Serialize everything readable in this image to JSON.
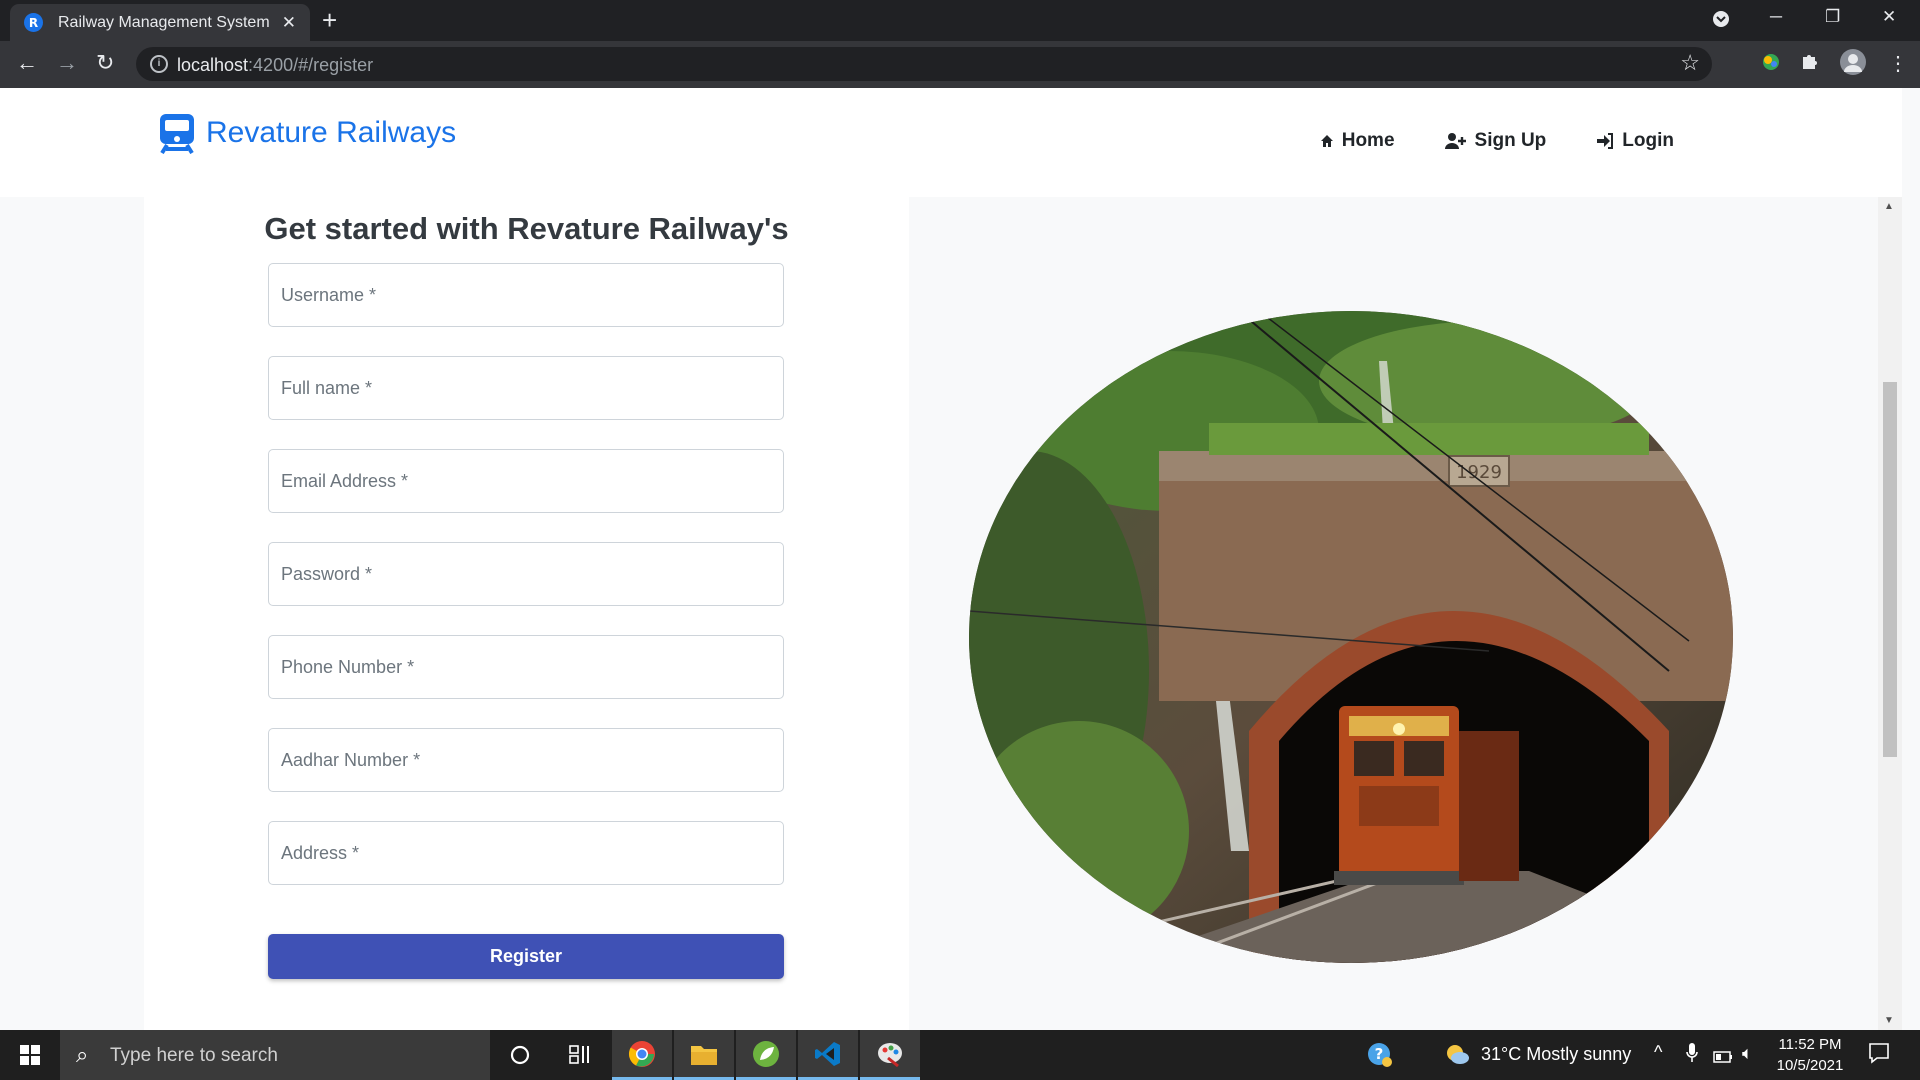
{
  "browser": {
    "tab_title": "Railway Management System",
    "tab_favicon_letter": "R",
    "url_host": "localhost",
    "url_rest": ":4200/#/register",
    "icons": [
      "back-arrow",
      "forward-arrow",
      "reload",
      "info",
      "star",
      "extensions",
      "profile",
      "menu"
    ]
  },
  "navbar": {
    "brand": "Revature Railways",
    "links": [
      {
        "label": "Home",
        "icon": "home-icon"
      },
      {
        "label": "Sign Up",
        "icon": "user-plus-icon"
      },
      {
        "label": "Login",
        "icon": "sign-in-icon"
      }
    ]
  },
  "form": {
    "title": "Get started with Revature Railway's",
    "fields": [
      {
        "placeholder": "Username *",
        "value": ""
      },
      {
        "placeholder": "Full name *",
        "value": ""
      },
      {
        "placeholder": "Email Address *",
        "value": ""
      },
      {
        "placeholder": "Password *",
        "value": ""
      },
      {
        "placeholder": "Phone Number *",
        "value": ""
      },
      {
        "placeholder": "Aadhar Number *",
        "value": ""
      },
      {
        "placeholder": "Address *",
        "value": ""
      }
    ],
    "submit_label": "Register"
  },
  "hero": {
    "plaque": "1929"
  },
  "taskbar": {
    "search_placeholder": "Type here to search",
    "weather": "31°C  Mostly sunny",
    "time": "11:52 PM",
    "date": "10/5/2021"
  },
  "colors": {
    "brand_blue": "#1a73e8",
    "register_button": "#3f51b5",
    "page_background": "#f8f9fa"
  }
}
